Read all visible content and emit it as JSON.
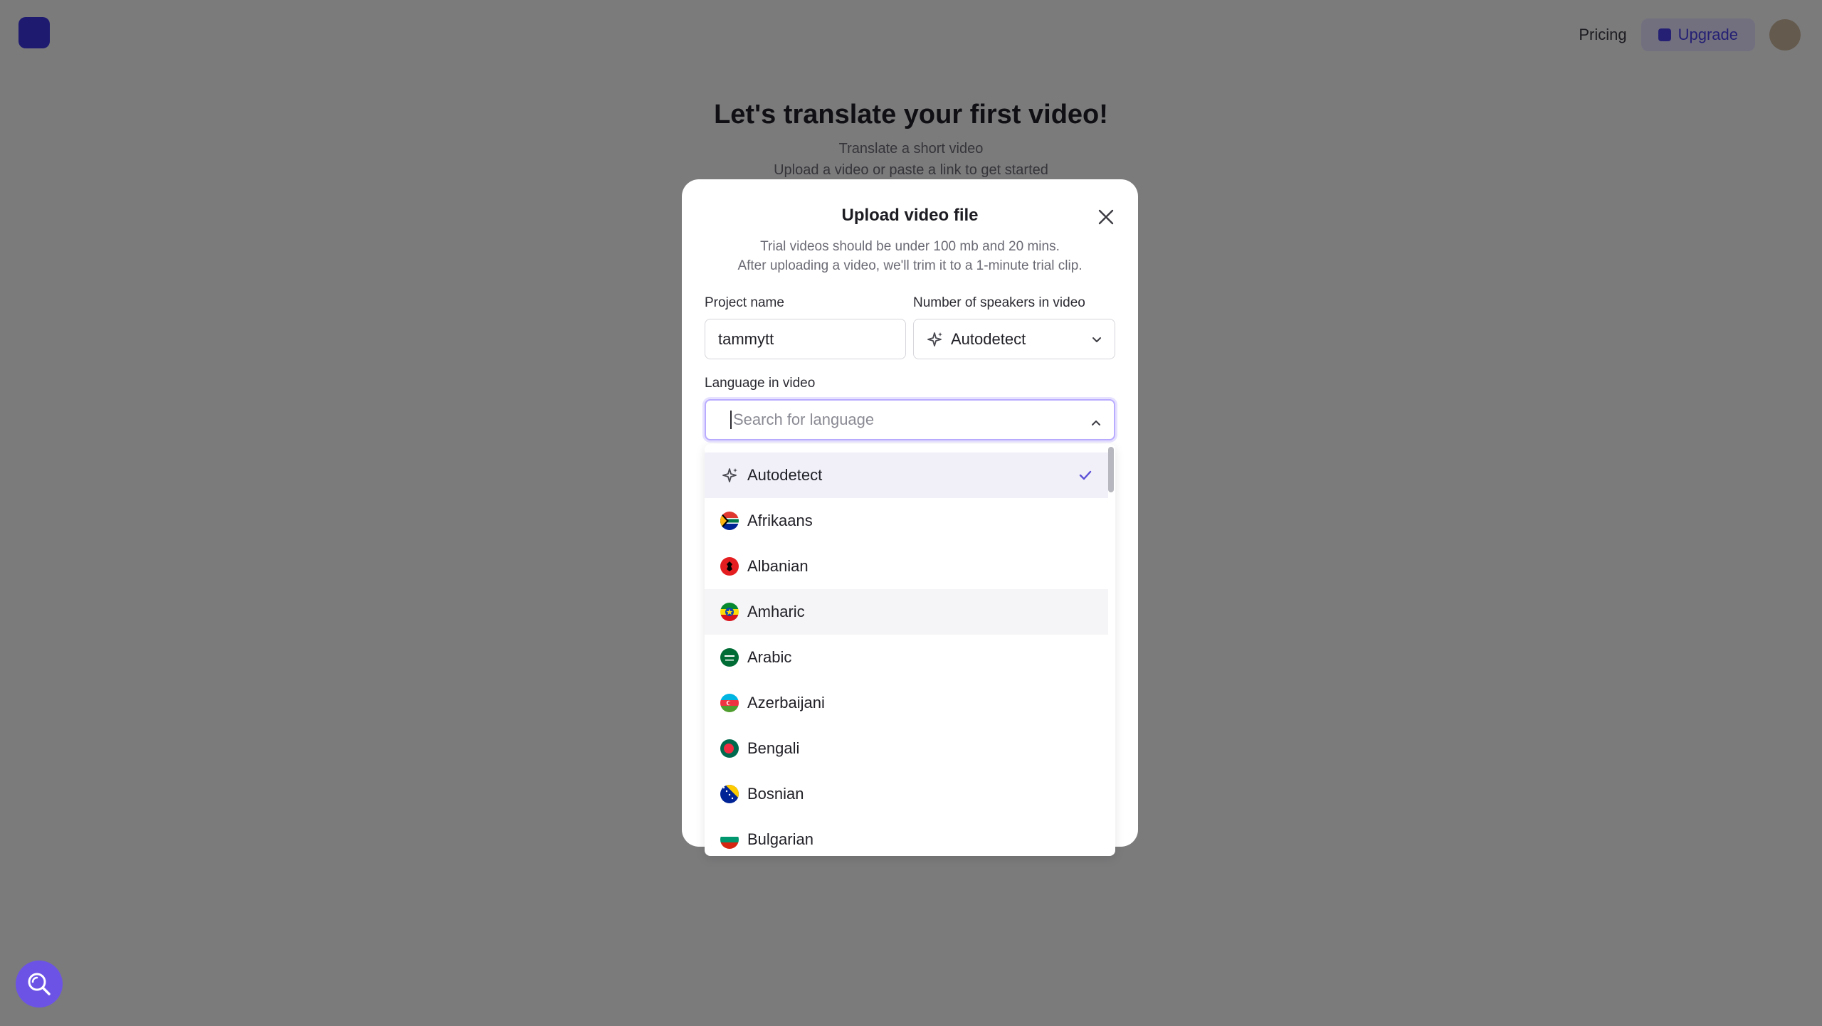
{
  "background": {
    "title": "Let's translate your first video!",
    "subtitle": "Translate a short video",
    "subtitle2": "Upload a video or paste a link to get started",
    "top_link": "Pricing",
    "upgrade_label": "Upgrade"
  },
  "modal": {
    "title": "Upload video file",
    "description_line1": "Trial videos should be under 100 mb and 20 mins.",
    "description_line2": "After uploading a video, we'll trim it to a 1-minute trial clip.",
    "project_name_label": "Project name",
    "project_name_value": "tammytt",
    "speakers_label": "Number of speakers in video",
    "speakers_value": "Autodetect",
    "language_label": "Language in video",
    "language_placeholder": "Search for language"
  },
  "languages": [
    {
      "label": "Autodetect",
      "icon": "sparkle-icon",
      "selected": true
    },
    {
      "label": "Afrikaans",
      "icon": "flag-south-africa-icon"
    },
    {
      "label": "Albanian",
      "icon": "flag-albania-icon"
    },
    {
      "label": "Amharic",
      "icon": "flag-ethiopia-icon",
      "hovered": true
    },
    {
      "label": "Arabic",
      "icon": "flag-saudi-arabia-icon"
    },
    {
      "label": "Azerbaijani",
      "icon": "flag-azerbaijan-icon"
    },
    {
      "label": "Bengali",
      "icon": "flag-bangladesh-icon"
    },
    {
      "label": "Bosnian",
      "icon": "flag-bosnia-icon"
    },
    {
      "label": "Bulgarian",
      "icon": "flag-bulgaria-icon"
    }
  ],
  "colors": {
    "accent": "#6c53e6",
    "focus_ring": "#b9acff",
    "selected_row": "#f1f0f9"
  }
}
